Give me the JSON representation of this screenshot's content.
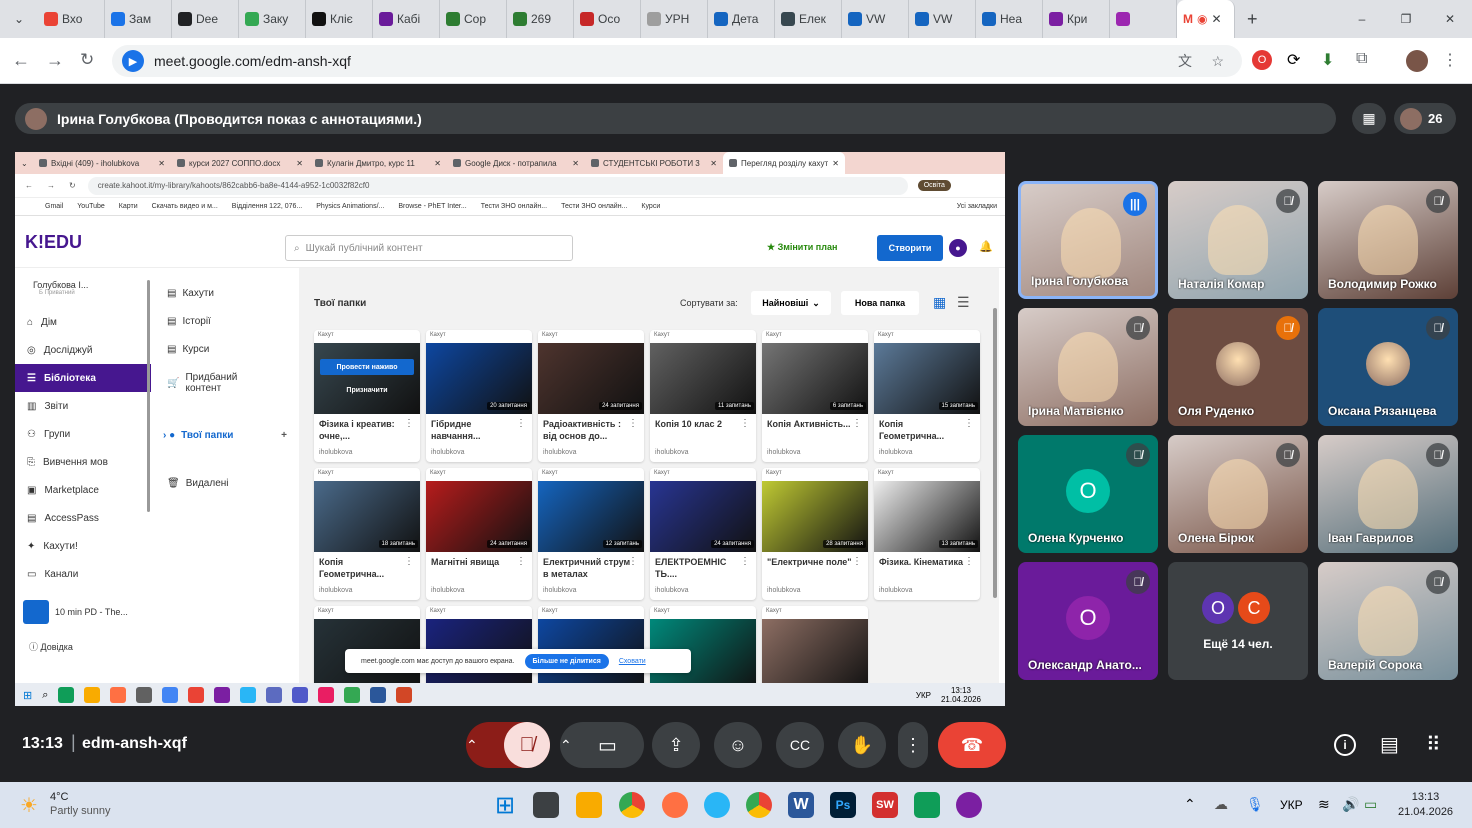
{
  "browser": {
    "tabs": [
      {
        "label": "Вхо",
        "color": "#ea4335"
      },
      {
        "label": "Зам",
        "color": "#1a73e8"
      },
      {
        "label": "Dee",
        "color": "#202124"
      },
      {
        "label": "Заку",
        "color": "#34a853"
      },
      {
        "label": "Кліє",
        "color": "#111111"
      },
      {
        "label": "Кабі",
        "color": "#6a1b9a"
      },
      {
        "label": "Сор",
        "color": "#2e7d32"
      },
      {
        "label": "269",
        "color": "#2e7d32"
      },
      {
        "label": "Осо",
        "color": "#c62828"
      },
      {
        "label": "УРН",
        "color": "#9e9e9e"
      },
      {
        "label": "Дета",
        "color": "#1565c0"
      },
      {
        "label": "Елек",
        "color": "#37474f"
      },
      {
        "label": "VW",
        "color": "#1565c0"
      },
      {
        "label": "VW",
        "color": "#1565c0"
      },
      {
        "label": "Неа",
        "color": "#1565c0"
      },
      {
        "label": "Кри",
        "color": "#7b1fa2"
      },
      {
        "label": "",
        "color": "#9c27b0"
      }
    ],
    "active_tab": "M",
    "new_tab": "+",
    "url": "meet.google.com/edm-ansh-xqf",
    "window_controls": [
      "–",
      "❐",
      "✕"
    ]
  },
  "meet": {
    "presenter_banner": "Ірина Голубкова (Проводится показ с аннотациями.)",
    "participant_count": "26",
    "time": "13:13",
    "meeting_code": "edm-ansh-xqf",
    "tiles": [
      {
        "name": "Ірина Голубкова",
        "kind": "video",
        "bg": "#a1887f",
        "muted": false,
        "active": true
      },
      {
        "name": "Наталія Комар",
        "kind": "video",
        "bg": "#90a4ae",
        "muted": true
      },
      {
        "name": "Володимир Рожко",
        "kind": "video",
        "bg": "#5d4037",
        "muted": true
      },
      {
        "name": "Ірина Матвієнко",
        "kind": "video",
        "bg": "#8d6e63",
        "muted": true
      },
      {
        "name": "Оля Руденко",
        "kind": "photo",
        "bg": "#6d4c41",
        "muted": true,
        "mic_color": "#e8710a"
      },
      {
        "name": "Оксана Рязанцева",
        "kind": "photo",
        "bg": "#1e4e79",
        "muted": true
      },
      {
        "name": "Олена Курченко",
        "kind": "letter",
        "letter": "О",
        "letter_bg": "#00bfa5",
        "bg": "#00796b",
        "muted": true
      },
      {
        "name": "Олена Бірюк",
        "kind": "video",
        "bg": "#795548",
        "muted": true
      },
      {
        "name": "Іван Гаврилов",
        "kind": "video",
        "bg": "#546e7a",
        "muted": true
      },
      {
        "name": "Олександр Анато...",
        "kind": "letter",
        "letter": "О",
        "letter_bg": "#8e24aa",
        "bg": "#6a1b9a",
        "muted": true
      },
      {
        "name": "Ещё 14 чел.",
        "kind": "more",
        "bg": "#3c4043"
      },
      {
        "name": "Валерій Сорока",
        "kind": "video",
        "bg": "#78909c",
        "muted": true
      }
    ],
    "more_letters": [
      "О",
      "С"
    ]
  },
  "shared": {
    "tabs": [
      "Вхідні (409) - iholubkova",
      "курси 2027 СОППО.docx",
      "Кулагін Дмитро, курс 11",
      "Google Диск - потрапила",
      "СТУДЕНТСЬКІ РОБОТИ 3",
      "Перегляд розділу кахутів"
    ],
    "url": "create.kahoot.it/my-library/kahoots/862cabb6-ba8e-4144-a952-1c0032f82cf0",
    "profile_label": "Освіта",
    "bookmarks": [
      "Gmail",
      "YouTube",
      "Карти",
      "Скачать видео и м...",
      "Відділення 122, 076...",
      "Physics Animations/...",
      "Browse - PhET Inter...",
      "Тести ЗНО онлайн...",
      "Тести ЗНО онлайн...",
      "Курси"
    ],
    "bookmarks_more": "Усі закладки",
    "logo": "K!EDU",
    "search_placeholder": "Шукай публічний контент",
    "upgrade": "Змінити план",
    "create": "Створити",
    "user": "Голубкова І...",
    "user_sub": "Б Приватний",
    "nav": [
      "Дім",
      "Досліджуй",
      "Бібліотека",
      "Звіти",
      "Групи",
      "Вивчення мов",
      "Marketplace",
      "AccessPass",
      "Кахути!",
      "Канали"
    ],
    "channel_item": "10 min PD - The...",
    "help": "Довідка",
    "lib_nav": [
      "Кахути",
      "Історії",
      "Курси",
      "Придбаний контент",
      "Твої папки",
      "Видалені"
    ],
    "folder_title": "Твої папки",
    "sort_label": "Сортувати за:",
    "sort_value": "Найновіші",
    "new_folder": "Нова папка",
    "kahoot_label": "Кахут",
    "cards": [
      {
        "title": "Фізика і креатив: очне,...",
        "count": "",
        "bg": "#37474f",
        "overlay": [
          "Провести наживо",
          "Призначити"
        ]
      },
      {
        "title": "Гібридне навчання...",
        "count": "20 запитання",
        "bg": "#0d47a1"
      },
      {
        "title": "Радіоактивність : від основ до...",
        "count": "24 запитання",
        "bg": "#4e342e"
      },
      {
        "title": "Копія 10 клас 2",
        "count": "11 запитань",
        "bg": "#616161"
      },
      {
        "title": "Копія Активність...",
        "count": "6 запитань",
        "bg": "#757575"
      },
      {
        "title": "Копія Геометрична...",
        "count": "15 запитань",
        "bg": "#5c7a99"
      },
      {
        "title": "Копія Геометрична...",
        "count": "18 запитань",
        "bg": "#4a6a8a"
      },
      {
        "title": "Магнітні явища",
        "count": "24 запитання",
        "bg": "#b71c1c"
      },
      {
        "title": "Електричний струм в металах",
        "count": "12 запитань",
        "bg": "#1565c0"
      },
      {
        "title": "ЕЛЕКТРОЕМНІС ТЬ....",
        "count": "24 запитання",
        "bg": "#283593"
      },
      {
        "title": "\"Електричне поле\"",
        "count": "28 запитання",
        "bg": "#c0ca33"
      },
      {
        "title": "Фізика. Кінематика",
        "count": "13 запитань",
        "bg": "#eeeeee"
      },
      {
        "title": "",
        "count": "",
        "bg": "#263238"
      },
      {
        "title": "",
        "count": "",
        "bg": "#1a237e"
      },
      {
        "title": "",
        "count": "",
        "bg": "#0d47a1"
      },
      {
        "title": "",
        "count": "",
        "bg": "#00897b"
      },
      {
        "title": "",
        "count": "",
        "bg": "#8d6e63"
      }
    ],
    "author": "iholubkova",
    "share_notice": "meet.google.com має доступ до вашого екрана.",
    "share_stop": "Більше не ділитися",
    "share_hide": "Сховати",
    "tray_lang": "УКР",
    "tray_time": "13:13",
    "tray_date": "21.04.2026"
  },
  "os": {
    "weather_temp": "4°C",
    "weather_desc": "Partly sunny",
    "lang": "УКР",
    "time": "13:13",
    "date": "21.04.2026"
  }
}
